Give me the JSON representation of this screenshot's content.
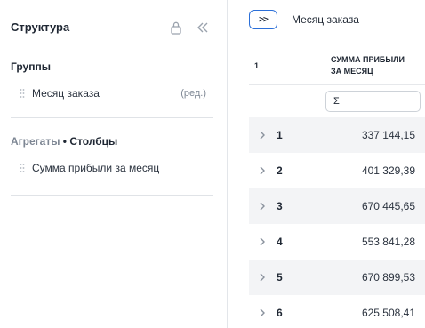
{
  "structure": {
    "title": "Структура",
    "groups_title": "Группы",
    "group_field": {
      "label": "Месяц заказа",
      "edit": "(ред.)"
    },
    "aggregates_prefix": "Агрегаты",
    "aggregates_suffix": " • Столбцы",
    "aggregate_field": {
      "label": "Сумма прибыли за месяц"
    }
  },
  "toolbar": {
    "toggle_label": ">>",
    "breadcrumb": "Месяц заказа",
    "more": "··"
  },
  "grid": {
    "col1_header": "1",
    "col2_header_line1": "СУММА ПРИБЫЛИ",
    "col2_header_line2": "ЗА МЕСЯЦ",
    "filter_symbol": "Σ",
    "rows": [
      {
        "key": "1",
        "value": "337 144,15"
      },
      {
        "key": "2",
        "value": "401 329,39"
      },
      {
        "key": "3",
        "value": "670 445,65"
      },
      {
        "key": "4",
        "value": "553 841,28"
      },
      {
        "key": "5",
        "value": "670 899,53"
      },
      {
        "key": "6",
        "value": "625 508,41"
      }
    ]
  }
}
